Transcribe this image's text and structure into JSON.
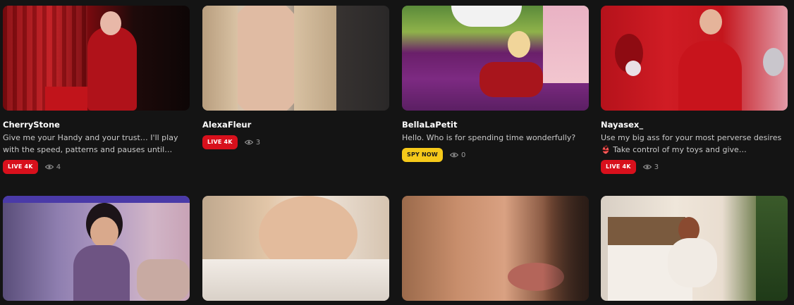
{
  "cards": [
    {
      "name": "CherryStone",
      "description": "Give me your Handy and your trust… I'll play with the speed, patterns and pauses until…",
      "badge": "LIVE 4K",
      "badge_type": "live",
      "viewers": "4"
    },
    {
      "name": "AlexaFleur",
      "description": "",
      "badge": "LIVE 4K",
      "badge_type": "live",
      "viewers": "3"
    },
    {
      "name": "BellaLaPetit",
      "description": "Hello. Who is for spending time wonderfully?",
      "badge": "SPY NOW",
      "badge_type": "spy",
      "viewers": "0"
    },
    {
      "name": "Nayasex_",
      "description": "Use my big ass for your most perverse desires 👙 Take control of my toys and give…",
      "badge": "LIVE 4K",
      "badge_type": "live",
      "viewers": "3"
    },
    {
      "name": "",
      "description": "",
      "badge": "",
      "badge_type": "",
      "viewers": ""
    },
    {
      "name": "",
      "description": "",
      "badge": "",
      "badge_type": "",
      "viewers": ""
    },
    {
      "name": "",
      "description": "",
      "badge": "",
      "badge_type": "",
      "viewers": ""
    },
    {
      "name": "",
      "description": "",
      "badge": "",
      "badge_type": "",
      "viewers": ""
    }
  ]
}
